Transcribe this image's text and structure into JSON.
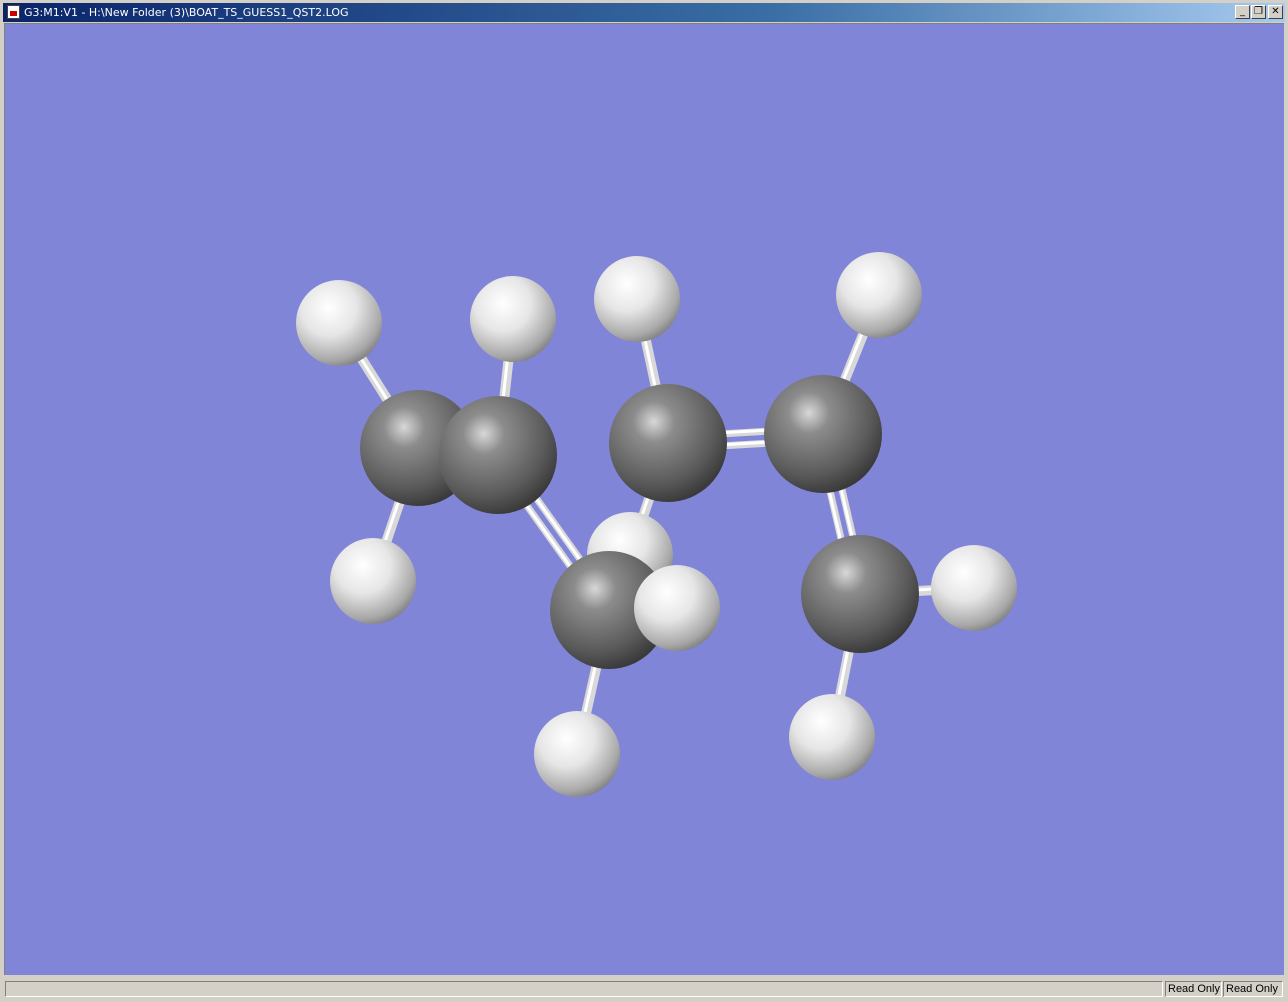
{
  "window": {
    "title": "G3:M1:V1 - H:\\New Folder (3)\\BOAT_TS_GUESS1_QST2.LOG",
    "minimize_label": "_",
    "restore_label": "❐",
    "close_label": "✕"
  },
  "viewport": {
    "background_color": "#8085d8",
    "atom_colors": {
      "carbon": "#6a6a6a",
      "hydrogen": "#dcdcdc"
    },
    "molecule_formula": "C6H10",
    "atom_count": {
      "carbon": 6,
      "hydrogen": 10
    }
  },
  "statusbar": {
    "cells": [
      "Read Only",
      "Read Only"
    ]
  }
}
